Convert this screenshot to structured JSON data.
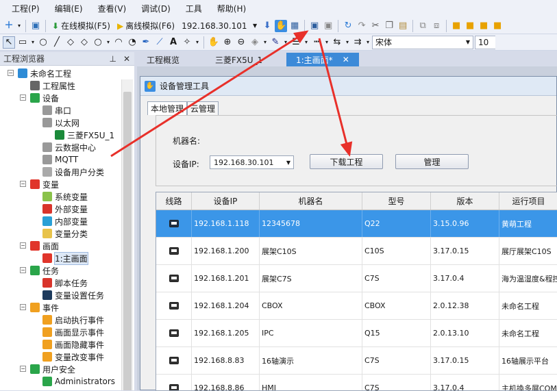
{
  "menu": [
    "工程(P)",
    "编辑(E)",
    "查看(V)",
    "调试(D)",
    "工具",
    "帮助(H)"
  ],
  "toolbar": {
    "online_sim": "在线模拟(F5)",
    "offline_sim": "离线模拟(F6)",
    "ip": "192.168.30.101",
    "font": "宋体",
    "font_size": "10"
  },
  "panel": {
    "title": "工程浏览器",
    "pin": "⊥",
    "close": "✕"
  },
  "tree": [
    {
      "label": "未命名工程",
      "icon": "project-icon",
      "indent": 0,
      "color": "#2d8bd6"
    },
    {
      "label": "工程属性",
      "icon": "properties-icon",
      "indent": 1,
      "color": "#666"
    },
    {
      "label": "设备",
      "icon": "device-icon",
      "indent": 1,
      "color": "#2aa54a"
    },
    {
      "label": "串口",
      "icon": "serial-icon",
      "indent": 2,
      "color": "#999"
    },
    {
      "label": "以太网",
      "icon": "ethernet-icon",
      "indent": 2,
      "color": "#999"
    },
    {
      "label": "三菱FX5U_1",
      "icon": "plc-icon",
      "indent": 3,
      "color": "#1b8a3a"
    },
    {
      "label": "云数据中心",
      "icon": "cloud-icon",
      "indent": 2,
      "color": "#999"
    },
    {
      "label": "MQTT",
      "icon": "mqtt-icon",
      "indent": 2,
      "color": "#999"
    },
    {
      "label": "设备用户分类",
      "icon": "user-category-icon",
      "indent": 2,
      "color": "#aaa"
    },
    {
      "label": "变量",
      "icon": "variable-icon",
      "indent": 1,
      "color": "#e0352b"
    },
    {
      "label": "系统变量",
      "icon": "system-variable-icon",
      "indent": 2,
      "color": "#8ac24a"
    },
    {
      "label": "外部变量",
      "icon": "external-variable-icon",
      "indent": 2,
      "color": "#d9342b"
    },
    {
      "label": "内部变量",
      "icon": "internal-variable-icon",
      "indent": 2,
      "color": "#2aa0d6"
    },
    {
      "label": "变量分类",
      "icon": "folder-icon",
      "indent": 2,
      "color": "#e8c34a"
    },
    {
      "label": "画面",
      "icon": "screen-icon",
      "indent": 1,
      "color": "#e0352b"
    },
    {
      "label": "1:主画面",
      "icon": "star-icon",
      "indent": 2,
      "color": "#e0352b"
    },
    {
      "label": "任务",
      "icon": "task-icon",
      "indent": 1,
      "color": "#2aa54a"
    },
    {
      "label": "脚本任务",
      "icon": "script-icon",
      "indent": 2,
      "color": "#d9342b"
    },
    {
      "label": "变量设置任务",
      "icon": "variable-task-icon",
      "indent": 2,
      "color": "#1d3a5c"
    },
    {
      "label": "事件",
      "icon": "event-icon",
      "indent": 1,
      "color": "#f0a020"
    },
    {
      "label": "启动执行事件",
      "icon": "startup-event-icon",
      "indent": 2,
      "color": "#f0a020"
    },
    {
      "label": "画面显示事件",
      "icon": "show-event-icon",
      "indent": 2,
      "color": "#f0a020"
    },
    {
      "label": "画面隐藏事件",
      "icon": "hide-event-icon",
      "indent": 2,
      "color": "#f0a020"
    },
    {
      "label": "变量改变事件",
      "icon": "change-event-icon",
      "indent": 2,
      "color": "#f0a020"
    },
    {
      "label": "用户安全",
      "icon": "security-icon",
      "indent": 1,
      "color": "#2aa54a"
    },
    {
      "label": "Administrators",
      "icon": "admin-group-icon",
      "indent": 2,
      "color": "#2aa54a"
    }
  ],
  "tabs": [
    "工程概览",
    "三菱FX5U_1",
    "1:主画面*"
  ],
  "dialog": {
    "title": "设备管理工具",
    "tabs": [
      "本地管理",
      "云管理"
    ],
    "machine_label": "机器名:",
    "ip_label": "设备IP:",
    "ip_value": "192.168.30.101",
    "download_btn": "下载工程",
    "manage_btn": "管理",
    "columns": [
      "线路",
      "设备IP",
      "机器名",
      "型号",
      "版本",
      "运行项目"
    ],
    "rows": [
      {
        "ip": "192.168.1.118",
        "name": "12345678",
        "model": "Q22",
        "version": "3.15.0.96",
        "project": "黄萌工程",
        "selected": true
      },
      {
        "ip": "192.168.1.200",
        "name": "展架C10S",
        "model": "C10S",
        "version": "3.17.0.15",
        "project": "展厅展架C10S",
        "selected": false
      },
      {
        "ip": "192.168.1.201",
        "name": "展架C7S",
        "model": "C7S",
        "version": "3.17.0.4",
        "project": "海为温湿度&程控",
        "selected": false
      },
      {
        "ip": "192.168.1.204",
        "name": "CBOX",
        "model": "CBOX",
        "version": "2.0.12.38",
        "project": "未命名工程",
        "selected": false
      },
      {
        "ip": "192.168.1.205",
        "name": "IPC",
        "model": "Q15",
        "version": "2.0.13.10",
        "project": "未命名工程",
        "selected": false
      },
      {
        "ip": "192.168.8.83",
        "name": "16轴演示",
        "model": "C7S",
        "version": "3.17.0.15",
        "project": "16轴展示平台",
        "selected": false
      },
      {
        "ip": "192.168.8.86",
        "name": "HMI",
        "model": "C7S",
        "version": "3.17.0.4",
        "project": "主机換多屏COMS",
        "selected": false
      }
    ]
  },
  "annotation_color": "#e8302a"
}
